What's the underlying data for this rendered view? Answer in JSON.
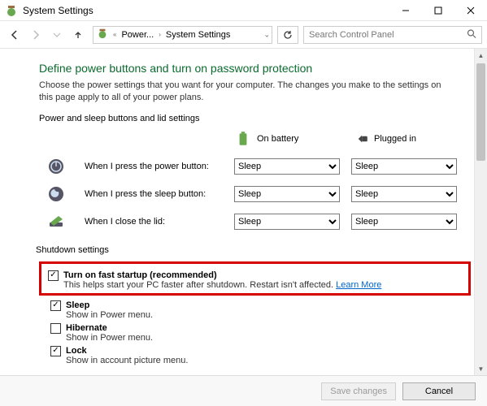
{
  "window": {
    "title": "System Settings"
  },
  "breadcrumb": {
    "ellipsis": "«",
    "part1": "Power...",
    "part2": "System Settings"
  },
  "search": {
    "placeholder": "Search Control Panel"
  },
  "page": {
    "heading": "Define power buttons and turn on password protection",
    "description": "Choose the power settings that you want for your computer. The changes you make to the settings on this page apply to all of your power plans.",
    "section_buttons": "Power and sleep buttons and lid settings",
    "col_battery": "On battery",
    "col_plugged": "Plugged in",
    "rows": [
      {
        "label": "When I press the power button:",
        "battery": "Sleep",
        "plugged": "Sleep"
      },
      {
        "label": "When I press the sleep button:",
        "battery": "Sleep",
        "plugged": "Sleep"
      },
      {
        "label": "When I close the lid:",
        "battery": "Sleep",
        "plugged": "Sleep"
      }
    ],
    "shutdown_heading": "Shutdown settings",
    "fast_startup": {
      "title": "Turn on fast startup (recommended)",
      "sub": "This helps start your PC faster after shutdown. Restart isn't affected. ",
      "link": "Learn More",
      "checked": true
    },
    "sleep": {
      "title": "Sleep",
      "sub": "Show in Power menu.",
      "checked": true
    },
    "hibernate": {
      "title": "Hibernate",
      "sub": "Show in Power menu.",
      "checked": false
    },
    "lock": {
      "title": "Lock",
      "sub": "Show in account picture menu.",
      "checked": true
    }
  },
  "footer": {
    "save": "Save changes",
    "cancel": "Cancel"
  }
}
